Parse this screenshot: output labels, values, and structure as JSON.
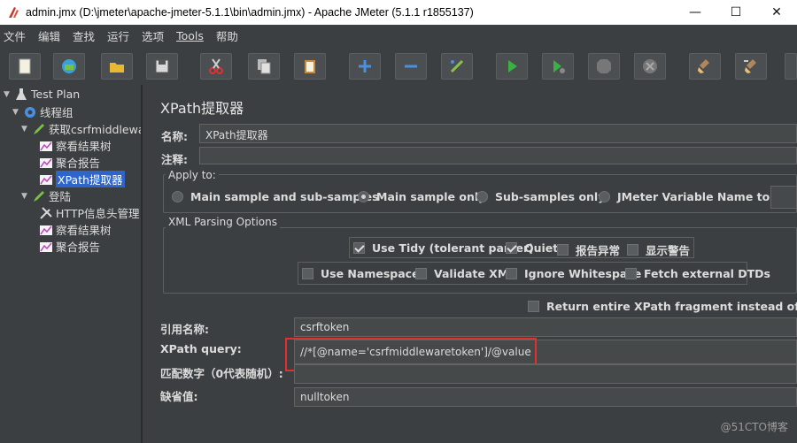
{
  "window": {
    "title": "admin.jmx (D:\\jmeter\\apache-jmeter-5.1.1\\bin\\admin.jmx) - Apache JMeter (5.1.1 r1855137)",
    "min": "—",
    "max": "☐",
    "close": "✕"
  },
  "menu": [
    "文件",
    "编辑",
    "查找",
    "运行",
    "选项",
    "Tools",
    "帮助"
  ],
  "toolbar": {
    "buttons": [
      "new-icon",
      "templates-icon",
      "open-icon",
      "save-icon",
      "cut-icon",
      "copy-icon",
      "paste-icon",
      "expand-icon",
      "collapse-icon",
      "toggle-icon",
      "start-icon",
      "start-no-pause-icon",
      "stop-icon",
      "shutdown-icon",
      "clear-icon",
      "clear-all-icon"
    ]
  },
  "tree": {
    "items": [
      {
        "label": "Test Plan",
        "icon": "flask-icon",
        "twisty": "▼"
      },
      {
        "label": "线程组",
        "icon": "gear-icon",
        "twisty": "▼"
      },
      {
        "label": "获取csrfmiddlewar",
        "icon": "pencil-icon",
        "twisty": "▼"
      },
      {
        "label": "察看结果树",
        "icon": "chart-icon",
        "twisty": ""
      },
      {
        "label": "聚合报告",
        "icon": "chart-icon",
        "twisty": ""
      },
      {
        "label": "XPath提取器",
        "icon": "chart-icon",
        "twisty": ""
      },
      {
        "label": "登陆",
        "icon": "pencil-icon",
        "twisty": "▼"
      },
      {
        "label": "HTTP信息头管理",
        "icon": "wrench-icon",
        "twisty": ""
      },
      {
        "label": "察看结果树",
        "icon": "chart-icon",
        "twisty": ""
      },
      {
        "label": "聚合报告",
        "icon": "chart-icon",
        "twisty": ""
      }
    ]
  },
  "panel": {
    "title": "XPath提取器",
    "name_label": "名称:",
    "name_value": "XPath提取器",
    "comment_label": "注释:",
    "comment_value": "",
    "apply_to": {
      "title": "Apply to:",
      "options": [
        {
          "label": "Main sample and sub-samples",
          "selected": false
        },
        {
          "label": "Main sample only",
          "selected": true
        },
        {
          "label": "Sub-samples only",
          "selected": false
        },
        {
          "label": "JMeter Variable Name to use",
          "selected": false
        }
      ]
    },
    "xml_options": {
      "title": "XML Parsing Options",
      "row1": [
        {
          "label": "Use Tidy (tolerant parser)",
          "checked": true
        },
        {
          "label": "Quiet",
          "checked": true
        },
        {
          "label": "报告异常",
          "checked": false
        },
        {
          "label": "显示警告",
          "checked": false
        }
      ],
      "row2": [
        {
          "label": "Use Namespaces",
          "checked": false
        },
        {
          "label": "Validate XML",
          "checked": false
        },
        {
          "label": "Ignore Whitespace",
          "checked": false
        },
        {
          "label": "Fetch external DTDs",
          "checked": false
        }
      ]
    },
    "return_fragment": {
      "label": "Return entire XPath fragment instead of text cont",
      "checked": false
    },
    "ref_name_label": "引用名称:",
    "ref_name_value": "csrftoken",
    "xpath_label": "XPath query:",
    "xpath_value": "//*[@name='csrfmiddlewaretoken']/@value",
    "match_label": "匹配数字（0代表随机）:",
    "match_value": "",
    "default_label": "缺省值:",
    "default_value": "nulltoken"
  },
  "watermark": "@51CTO博客",
  "colors": {
    "accent": "#2f65ca",
    "highlight_box": "#e03030"
  }
}
